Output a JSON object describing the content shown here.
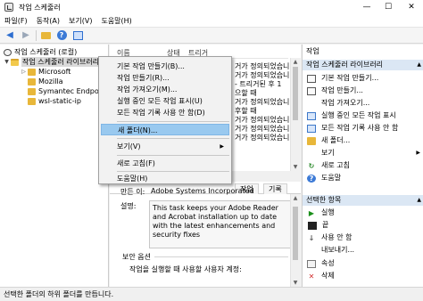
{
  "window": {
    "title": "작업 스케줄러",
    "minimize": "—",
    "maximize": "☐",
    "close": "✕"
  },
  "menubar": [
    "파일(F)",
    "동작(A)",
    "보기(V)",
    "도움말(H)"
  ],
  "toolbar": {
    "back": "◀",
    "forward": "▶"
  },
  "tree": {
    "root": "작업 스케줄러 (로컬)",
    "library": "작업 스케줄러 라이브러리",
    "folders": [
      "Microsoft",
      "Mozilla",
      "Symantec Endpoint P",
      "wsl-static-ip"
    ]
  },
  "middle": {
    "columns": {
      "name": "이름",
      "status": "상태",
      "triggers": "트리거"
    },
    "rows": [
      "거가 정의되었습니",
      "거가 정의되었습니",
      "- 트리거된 후 1",
      "으할 때",
      "거가 정의되었습니",
      "후할 때",
      "거가 정의되었습니",
      "거가 정의되었습니",
      "거가 정의되었습니"
    ],
    "tabs": [
      "작업",
      "기록"
    ],
    "author_label": "만든 이:",
    "author_value": "Adobe Systems Incorporated",
    "desc_label": "설명:",
    "desc_value": "This task keeps your Adobe Reader and Acrobat installation up to date with the latest enhancements and security fixes",
    "security_head": "보안 옵션",
    "security_text": "작업을 실행할 때 사용할 사용자 계정:"
  },
  "context_menu": {
    "items": [
      "기본 작업 만들기(B)...",
      "작업 만들기(R)...",
      "작업 가져오기(M)...",
      "실행 중인 모든 작업 표시(U)",
      "모든 작업 기록 사용 안 함(D)",
      "새 폴더(N)...",
      "보기(V)",
      "새로 고침(F)",
      "도움말(H)"
    ],
    "submenu_arrow": "▶"
  },
  "actions": {
    "pane_title": "작업",
    "section1_title": "작업 스케줄러 라이브러리",
    "section1_items": [
      "기본 작업 만들기...",
      "작업 만들기...",
      "작업 가져오기...",
      "실행 중인 모든 작업 표시",
      "모든 작업 기록 사용 안 함",
      "새 폴더...",
      "보기",
      "새로 고침",
      "도움말"
    ],
    "section2_title": "선택한 항목",
    "section2_items": [
      "실행",
      "끝",
      "사용 안 함",
      "내보내기...",
      "속성",
      "삭제"
    ],
    "collapse_arrow": "▲",
    "submenu_arrow": "▶"
  },
  "statusbar": {
    "text": "선택한 폴더의 하위 폴더를 만듭니다."
  },
  "colors": {
    "highlight": "#99c9ef",
    "action_header": "#dbe7f4"
  }
}
